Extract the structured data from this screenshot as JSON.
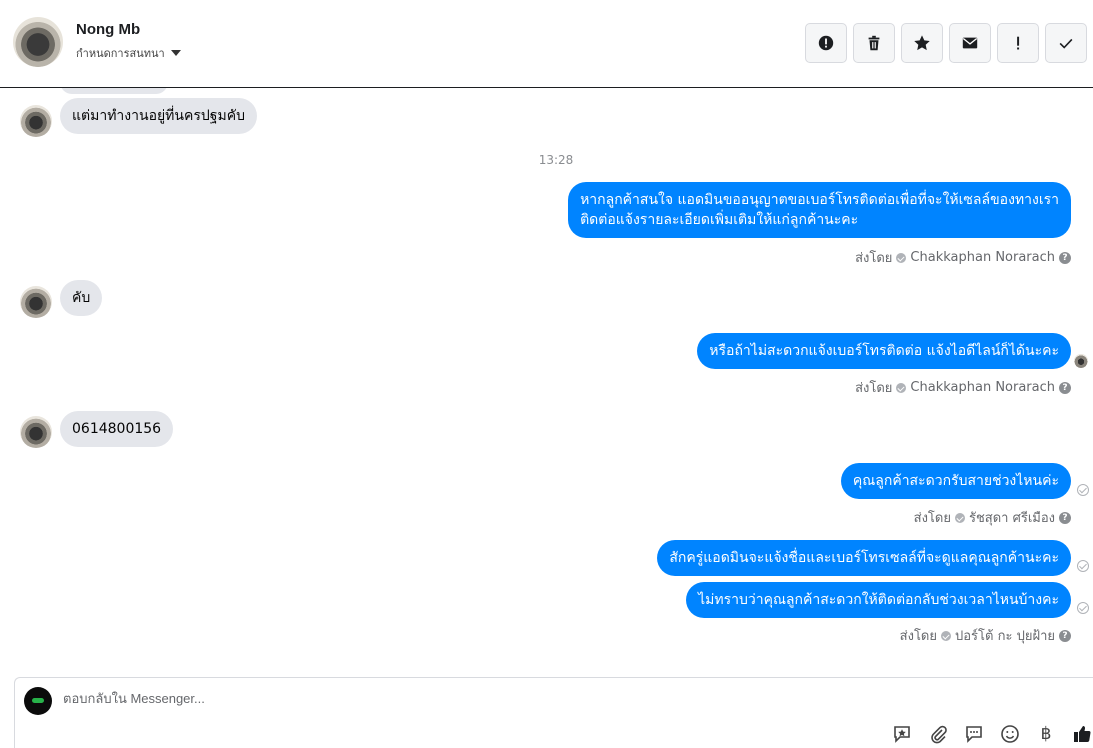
{
  "header": {
    "contact_name": "Nong Mb",
    "subtitle": "กำหนดการสนทนา"
  },
  "toolbar": {
    "buttons": [
      "spam-report",
      "delete",
      "star",
      "mark-unread",
      "important",
      "done"
    ]
  },
  "messages": {
    "timestamp": "13:28",
    "in_1": "แต่มาทำงานอยู่ที่นครปฐมคับ",
    "out_1_line1": "หากลูกค้าสนใจ แอดมินขออนุญาตขอเบอร์โทรติดต่อเพื่อที่จะให้เซลล์ของทางเรา",
    "out_1_line2": "ติดต่อแจ้งรายละเอียดเพิ่มเติมให้แก่ลูกค้านะคะ",
    "sent_by_label": "ส่งโดย",
    "sender_1": "Chakkaphan Norarach",
    "in_2": "คับ",
    "out_2": "หรือถ้าไม่สะดวกแจ้งเบอร์โทรติดต่อ แจ้งไอดีไลน์ก็ได้นะคะ",
    "sender_2": "Chakkaphan Norarach",
    "in_3": "0614800156",
    "out_3": "คุณลูกค้าสะดวกรับสายช่วงไหนค่ะ",
    "sender_3": "รัชสุดา ศรีเมือง",
    "out_4": "สักครู่แอดมินจะแจ้งชื่อและเบอร์โทรเซลล์ที่จะดูแลคุณลูกค้านะคะ",
    "out_5": "ไม่ทราบว่าคุณลูกค้าสะดวกให้ติดต่อกลับช่วงเวลาไหนบ้างคะ",
    "sender_4": "ปอร์โต้ กะ ปุยฝ้าย"
  },
  "composer": {
    "placeholder": "ตอบกลับใน Messenger...",
    "icons": [
      "saved-reply-icon",
      "attachment-icon",
      "chat-bubble-icon",
      "emoji-icon",
      "baht-icon",
      "like-icon"
    ],
    "baht_symbol": "฿"
  },
  "colors": {
    "outgoing_bubble": "#0084ff",
    "incoming_bubble": "#e4e6eb"
  }
}
